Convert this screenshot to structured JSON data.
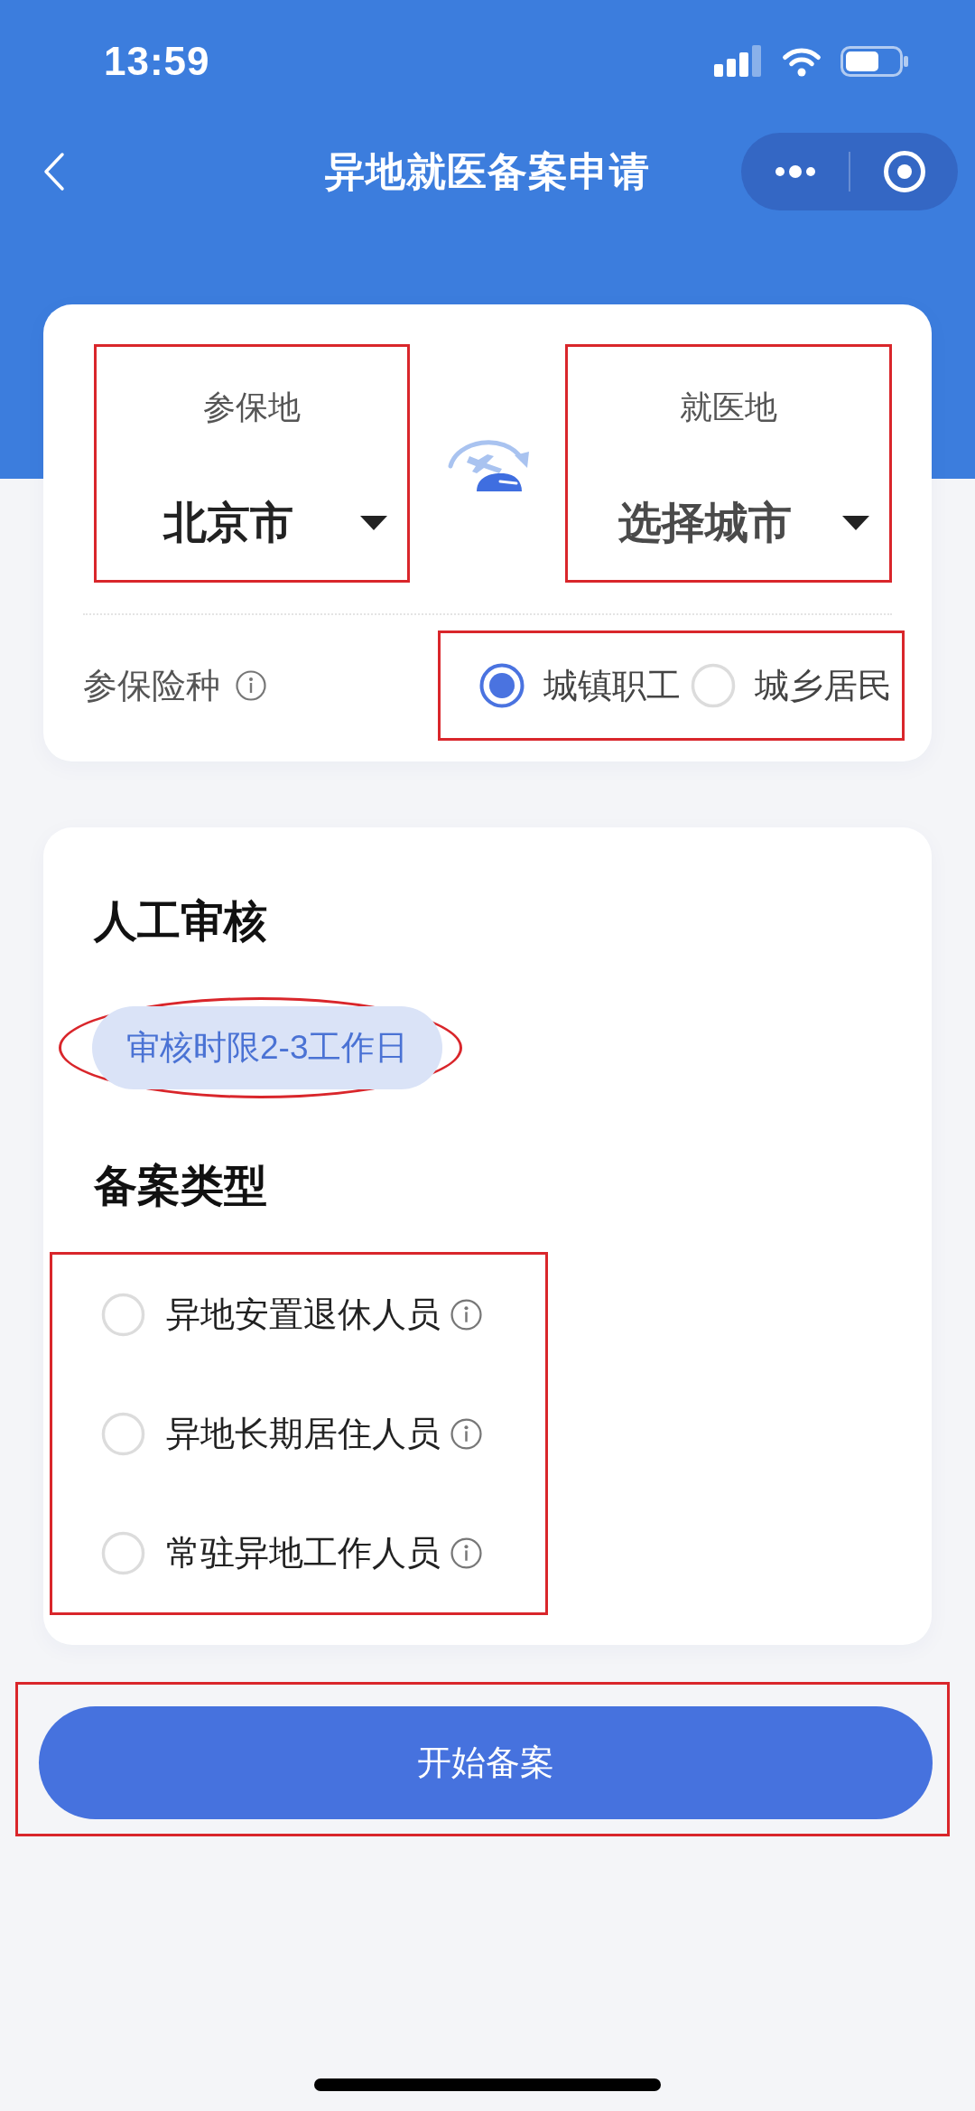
{
  "status_bar": {
    "time": "13:59"
  },
  "nav_bar": {
    "title": "异地就医备案申请"
  },
  "location_card": {
    "fields": [
      {
        "label": "参保地",
        "value": "北京市",
        "highlighted": true
      },
      {
        "label": "就医地",
        "placeholder": "选择城市",
        "highlighted": true
      }
    ],
    "insurance_type": {
      "label": "参保险种",
      "highlighted": true,
      "options": [
        {
          "label": "城镇职工",
          "selected": true
        },
        {
          "label": "城乡居民",
          "selected": false
        }
      ]
    }
  },
  "review_card": {
    "title": "人工审核",
    "badge": {
      "text": "审核时限2-3工作日",
      "highlighted": true
    },
    "filing_type": {
      "title": "备案类型",
      "highlighted": true,
      "options": [
        {
          "label": "异地安置退休人员",
          "selected": false
        },
        {
          "label": "异地长期居住人员",
          "selected": false
        },
        {
          "label": "常驻异地工作人员",
          "selected": false
        }
      ]
    }
  },
  "submit_button": {
    "label": "开始备案",
    "highlighted": true
  }
}
